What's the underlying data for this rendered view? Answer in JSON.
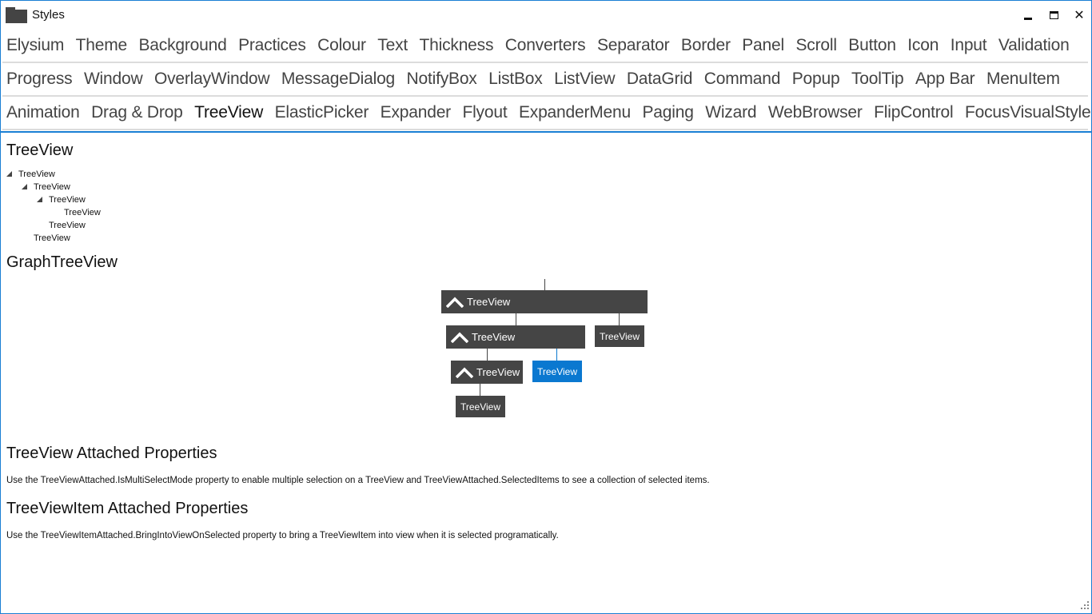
{
  "window": {
    "title": "Styles",
    "app_icon": "folder-icon",
    "controls": {
      "minimize": "minimize-icon",
      "maximize": "maximize-icon",
      "close": "✕"
    },
    "accent_color": "#1a7fd4"
  },
  "nav": {
    "rows": [
      [
        "Elysium",
        "Theme",
        "Background",
        "Practices",
        "Colour",
        "Text",
        "Thickness",
        "Converters",
        "Separator",
        "Border",
        "Panel",
        "Scroll",
        "Button",
        "Icon",
        "Input",
        "Validation"
      ],
      [
        "Progress",
        "Window",
        "OverlayWindow",
        "MessageDialog",
        "NotifyBox",
        "ListBox",
        "ListView",
        "DataGrid",
        "Command",
        "Popup",
        "ToolTip",
        "App Bar",
        "MenuItem"
      ],
      [
        "Animation",
        "Drag & Drop",
        "TreeView",
        "ElasticPicker",
        "Expander",
        "Flyout",
        "ExpanderMenu",
        "Paging",
        "Wizard",
        "WebBrowser",
        "FlipControl",
        "FocusVisualStyle"
      ]
    ],
    "active": "TreeView"
  },
  "content": {
    "treeview_heading": "TreeView",
    "tree": [
      {
        "label": "TreeView",
        "depth": 0,
        "expanded": true
      },
      {
        "label": "TreeView",
        "depth": 1,
        "expanded": true
      },
      {
        "label": "TreeView",
        "depth": 2,
        "expanded": true
      },
      {
        "label": "TreeView",
        "depth": 3,
        "expanded": false
      },
      {
        "label": "TreeView",
        "depth": 2,
        "expanded": false
      },
      {
        "label": "TreeView",
        "depth": 1,
        "expanded": false
      }
    ],
    "graph_heading": "GraphTreeView",
    "graph_nodes": {
      "root": {
        "label": "TreeView",
        "expanded": true
      },
      "child_a": {
        "label": "TreeView",
        "expanded": true
      },
      "child_b": {
        "label": "TreeView"
      },
      "grandchild_a": {
        "label": "TreeView",
        "expanded": true
      },
      "grandchild_b": {
        "label": "TreeView",
        "selected": true
      },
      "great_grandchild": {
        "label": "TreeView"
      }
    },
    "attached_heading": "TreeView Attached Properties",
    "attached_text": "Use the TreeViewAttached.IsMultiSelectMode property to enable multiple selection on a TreeView and TreeViewAttached.SelectedItems to see a collection of selected items.",
    "item_attached_heading": "TreeViewItem Attached Properties",
    "item_attached_text": "Use the TreeViewItemAttached.BringIntoViewOnSelected property to bring a TreeViewItem into view when it is selected programatically."
  }
}
